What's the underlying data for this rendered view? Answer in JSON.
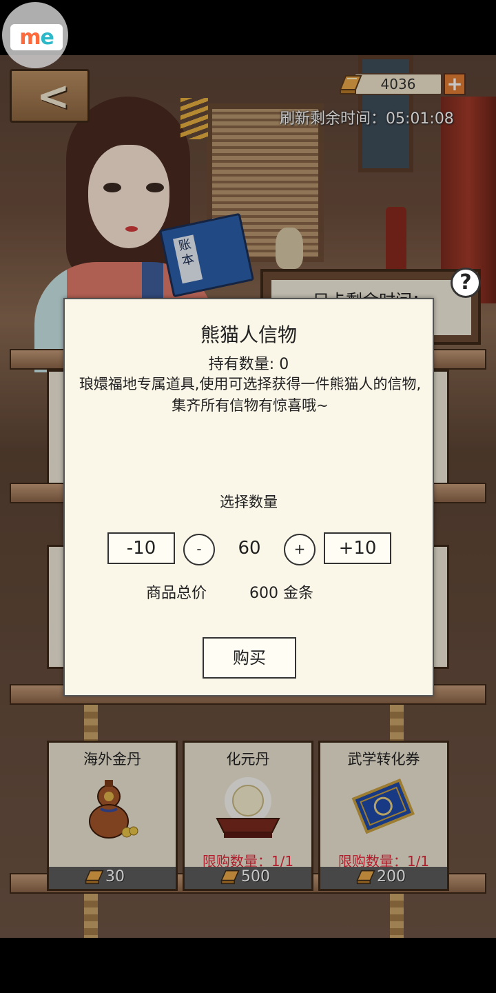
{
  "app_badge": {
    "text_m": "m",
    "text_e": "e"
  },
  "header": {
    "back_arrow": "<",
    "gold_amount": "4036",
    "plus_label": "+",
    "refresh_text": "刷新剩余时间：05:01:08",
    "help_label": "?"
  },
  "background_sign": {
    "text": "只卡剩余时间："
  },
  "modal": {
    "title": "熊猫人信物",
    "held_count": "持有数量: 0",
    "description": "琅嬛福地专属道具,使用可选择获得一件熊猫人的信物,集齐所有信物有惊喜哦~",
    "select_label": "选择数量",
    "minus10_label": "-10",
    "minus_label": "-",
    "quantity": "60",
    "plus_label": "+",
    "plus10_label": "+10",
    "total_label": "商品总价",
    "total_value": "600 金条",
    "buy_label": "购买"
  },
  "items": [
    {
      "name": "海外金丹",
      "limit": "",
      "price": "30",
      "icon": "gourd-icon"
    },
    {
      "name": "化元丹",
      "limit": "限购数量：1/1",
      "price": "500",
      "icon": "pill-icon"
    },
    {
      "name": "武学转化券",
      "limit": "限购数量：1/1",
      "price": "200",
      "icon": "ticket-icon"
    }
  ],
  "colors": {
    "limit_red": "#e0283a",
    "plus_orange": "#e27d32",
    "modal_bg": "#faf6e8",
    "price_bar": "#5b5b5b"
  }
}
